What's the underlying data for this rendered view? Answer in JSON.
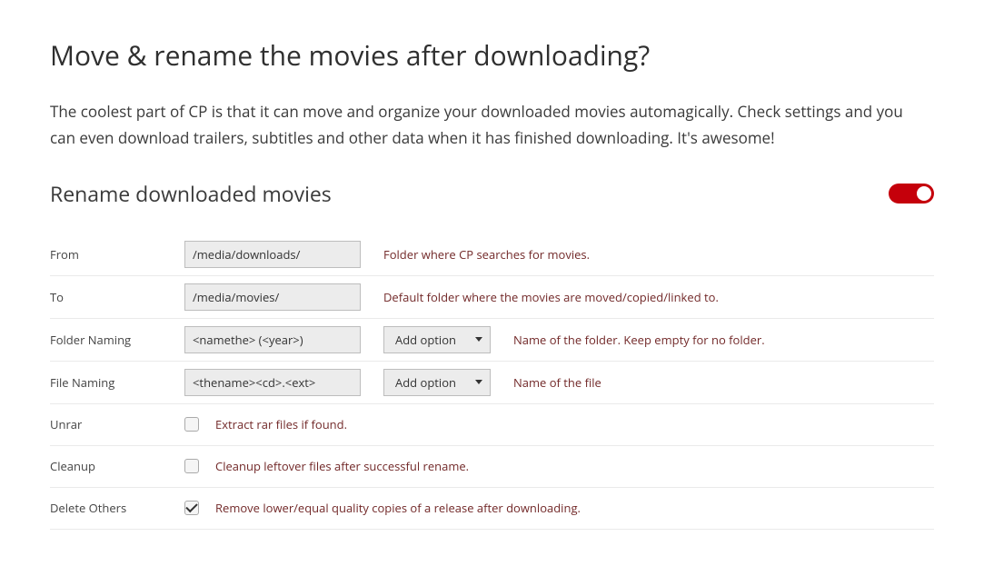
{
  "title": "Move & rename the movies after downloading?",
  "description": "The coolest part of CP is that it can move and organize your downloaded movies automagically. Check settings and you can even download trailers, subtitles and other data when it has finished downloading. It's awesome!",
  "section": {
    "heading": "Rename downloaded movies",
    "enabled": true
  },
  "fields": {
    "from": {
      "label": "From",
      "value": "/media/downloads/",
      "help": "Folder where CP searches for movies."
    },
    "to": {
      "label": "To",
      "value": "/media/movies/",
      "help": "Default folder where the movies are moved/copied/linked to."
    },
    "folder_naming": {
      "label": "Folder Naming",
      "value": "<namethe> (<year>)",
      "dropdown_label": "Add option",
      "help": "Name of the folder. Keep empty for no folder."
    },
    "file_naming": {
      "label": "File Naming",
      "value": "<thename><cd>.<ext>",
      "dropdown_label": "Add option",
      "help": "Name of the file"
    },
    "unrar": {
      "label": "Unrar",
      "checked": false,
      "help": "Extract rar files if found."
    },
    "cleanup": {
      "label": "Cleanup",
      "checked": false,
      "help": "Cleanup leftover files after successful rename."
    },
    "delete_others": {
      "label": "Delete Others",
      "checked": true,
      "help": "Remove lower/equal quality copies of a release after downloading."
    }
  }
}
